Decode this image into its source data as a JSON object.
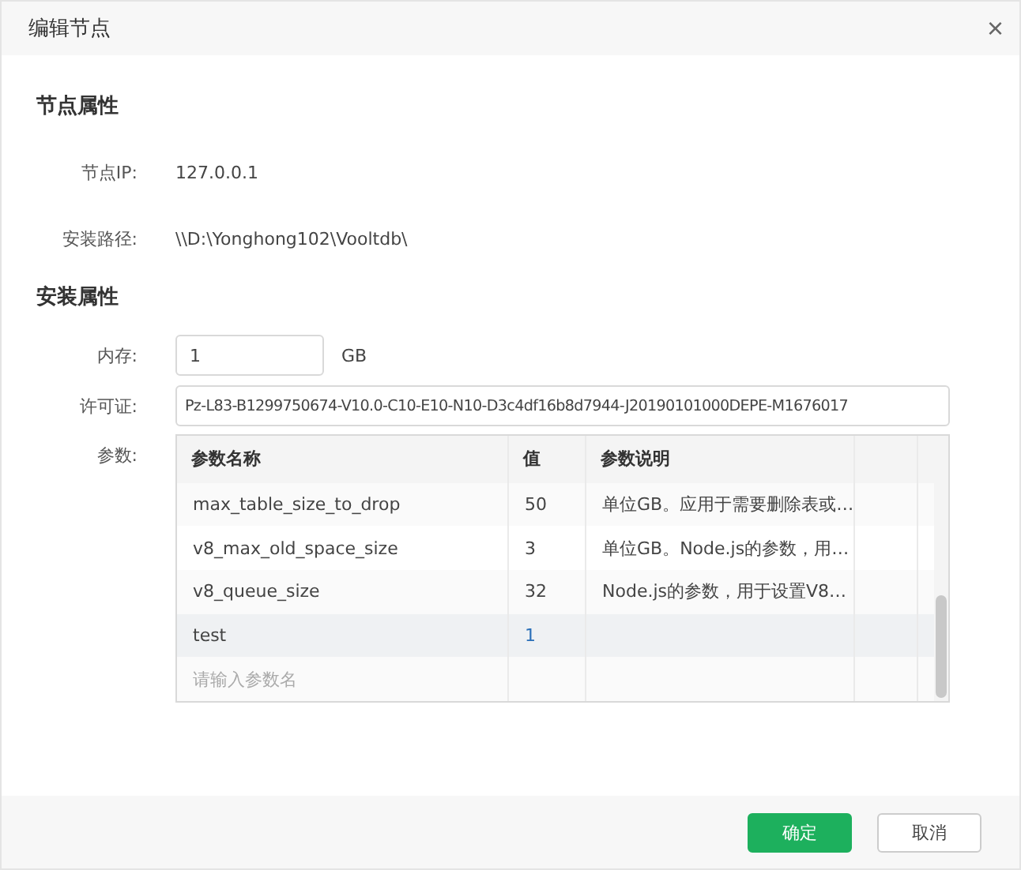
{
  "window": {
    "title": "编辑节点",
    "close": "×"
  },
  "node_section": {
    "heading": "节点属性",
    "fields": [
      {
        "label": "节点IP:",
        "value": "127.0.0.1"
      },
      {
        "label": "安装路径:",
        "value": "\\\\D:\\Yonghong102\\Vooltdb\\"
      }
    ]
  },
  "install_section": {
    "heading": "安装属性",
    "memory": {
      "label": "内存:",
      "value": "1",
      "unit": "GB"
    },
    "license": {
      "label": "许可证:",
      "value": "Pz-L83-B1299750674-V10.0-C10-E10-N10-D3c4df16b8d7944-J20190101000DEPE-M1676017"
    },
    "params": {
      "label": "参数:",
      "columns": [
        "参数名称",
        "值",
        "参数说明"
      ],
      "rows": [
        {
          "name": "max_table_size_to_drop",
          "value": "50",
          "description": "单位GB。应用于需要删除表或…",
          "selected": false
        },
        {
          "name": "v8_max_old_space_size",
          "value": "3",
          "description": "单位GB。Node.js的参数，用…",
          "selected": false
        },
        {
          "name": "v8_queue_size",
          "value": "32",
          "description": "Node.js的参数，用于设置V8…",
          "selected": false
        },
        {
          "name": "test",
          "value": "1",
          "description": "",
          "selected": true
        }
      ],
      "new_row_placeholder": "请输入参数名"
    }
  },
  "buttons": [
    {
      "label": "确定",
      "kind": "primary"
    },
    {
      "label": "取消",
      "kind": "secondary"
    }
  ]
}
